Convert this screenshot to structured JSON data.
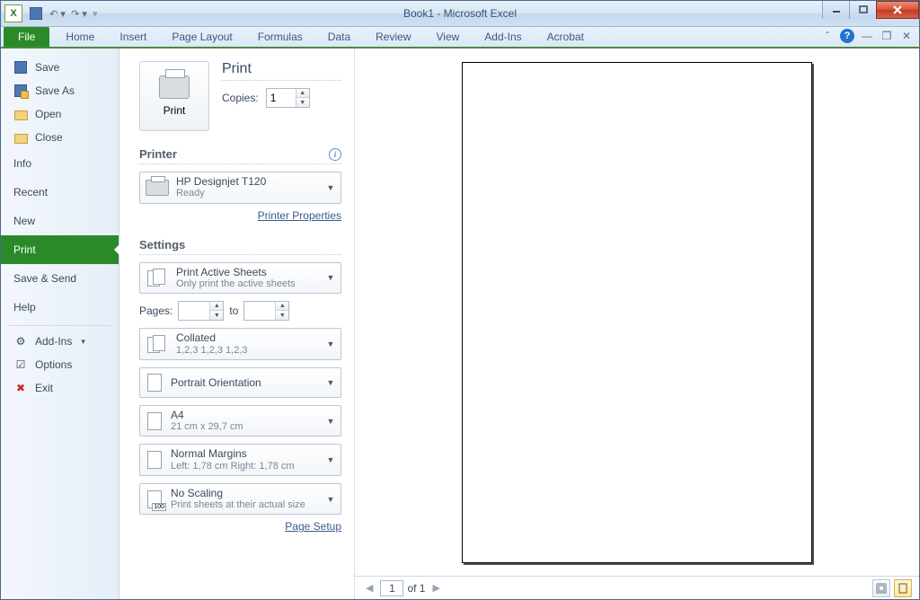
{
  "titlebar": {
    "title": "Book1 - Microsoft Excel"
  },
  "ribbon_tabs": {
    "file": "File",
    "tabs": [
      "Home",
      "Insert",
      "Page Layout",
      "Formulas",
      "Data",
      "Review",
      "View",
      "Add-Ins",
      "Acrobat"
    ]
  },
  "backstage": {
    "save": "Save",
    "save_as": "Save As",
    "open": "Open",
    "close": "Close",
    "info": "Info",
    "recent": "Recent",
    "new": "New",
    "print": "Print",
    "save_send": "Save & Send",
    "help": "Help",
    "addins": "Add-Ins",
    "options": "Options",
    "exit": "Exit"
  },
  "print": {
    "header": "Print",
    "button_label": "Print",
    "copies_label": "Copies:",
    "copies_value": "1",
    "printer_header": "Printer",
    "printer_name": "HP Designjet T120",
    "printer_status": "Ready",
    "printer_properties": "Printer Properties",
    "settings_header": "Settings",
    "print_what_title": "Print Active Sheets",
    "print_what_sub": "Only print the active sheets",
    "pages_label": "Pages:",
    "pages_to": "to",
    "collate_title": "Collated",
    "collate_sub": "1,2,3    1,2,3    1,2,3",
    "orientation": "Portrait Orientation",
    "paper_title": "A4",
    "paper_sub": "21 cm x 29,7 cm",
    "margins_title": "Normal Margins",
    "margins_sub": "Left: 1,78 cm   Right: 1,78 cm",
    "scaling_title": "No Scaling",
    "scaling_sub": "Print sheets at their actual size",
    "page_setup": "Page Setup"
  },
  "preview": {
    "current_page": "1",
    "of_label": "of 1"
  }
}
